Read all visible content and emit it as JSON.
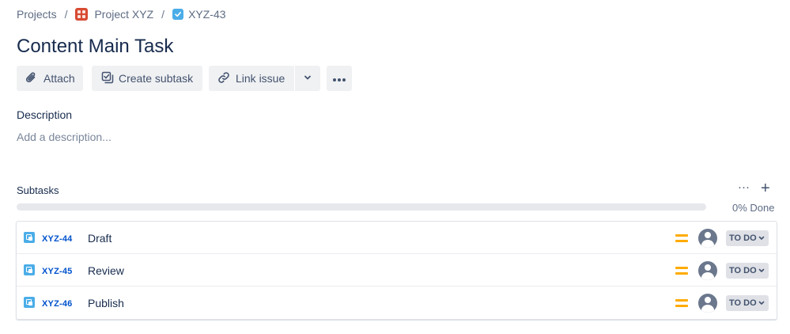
{
  "breadcrumb": {
    "projects": "Projects",
    "separator": "/",
    "project_name": "Project XYZ",
    "issue_key": "XYZ-43"
  },
  "issue": {
    "title": "Content Main Task"
  },
  "toolbar": {
    "attach_label": "Attach",
    "create_subtask_label": "Create subtask",
    "link_issue_label": "Link issue"
  },
  "description": {
    "label": "Description",
    "placeholder": "Add a description..."
  },
  "subtasks": {
    "label": "Subtasks",
    "more_label": "···",
    "add_label": "+",
    "progress_fraction": 0,
    "progress_text": "0% Done",
    "items": [
      {
        "key": "XYZ-44",
        "summary": "Draft",
        "status": "TO DO"
      },
      {
        "key": "XYZ-45",
        "summary": "Review",
        "status": "TO DO"
      },
      {
        "key": "XYZ-46",
        "summary": "Publish",
        "status": "TO DO"
      }
    ]
  },
  "colors": {
    "link": "#0052cc",
    "priority_medium": "#ffab00",
    "subtask_icon": "#4bade8",
    "project_icon": "#d84a33"
  },
  "icons": {
    "attach": "paperclip-icon",
    "create_subtask": "subtask-checkbox-icon",
    "link_issue": "link-icon",
    "dropdown": "chevron-down-icon",
    "more": "more-dots-icon",
    "priority": "priority-medium-icon",
    "assignee": "avatar-placeholder-icon"
  }
}
